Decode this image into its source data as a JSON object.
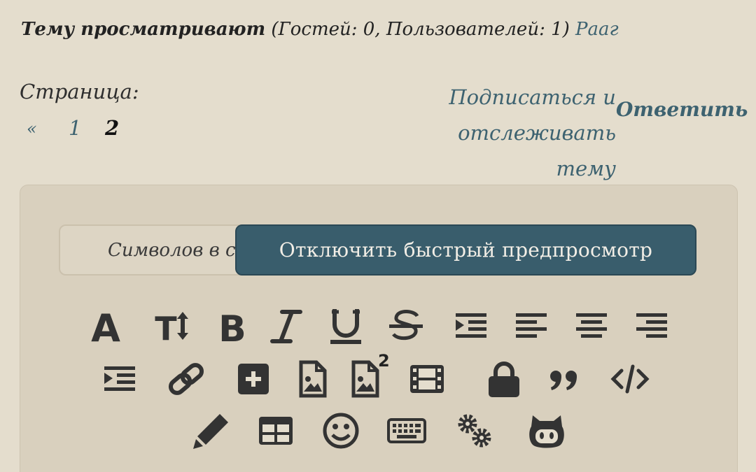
{
  "viewers": {
    "label": "Тему просматривают",
    "counts": "(Гостей: 0, Пользователей: 1)",
    "user": "Рааг"
  },
  "pagination": {
    "label": "Страница:",
    "prev": "«",
    "pages": [
      "1",
      "2"
    ],
    "current": "2"
  },
  "actions": {
    "subscribe_line1": "Подписаться и отслеживать",
    "subscribe_line2": "тему",
    "reply": "Ответить"
  },
  "editor": {
    "counter_text": "Символов в сообщении",
    "preview_toggle": "Отключить быстрый предпросмотр",
    "attach_badge": "2",
    "toolbar": [
      "font-icon",
      "font-size-icon",
      "bold-icon",
      "italic-icon",
      "underline-icon",
      "strikethrough-icon",
      "indent-icon",
      "align-left-icon",
      "align-center-icon",
      "align-right-icon",
      "outdent-icon",
      "link-icon",
      "add-box-icon",
      "image-file-icon",
      "image-file-2-icon",
      "video-icon",
      "lock-icon",
      "quote-icon",
      "code-icon",
      "pencil-icon",
      "table-icon",
      "smiley-icon",
      "keyboard-icon",
      "settings-gears-icon",
      "github-icon"
    ]
  },
  "colors": {
    "background": "#e4ddcd",
    "link": "#3d6270",
    "button": "#395d6c",
    "icon": "#333333"
  }
}
